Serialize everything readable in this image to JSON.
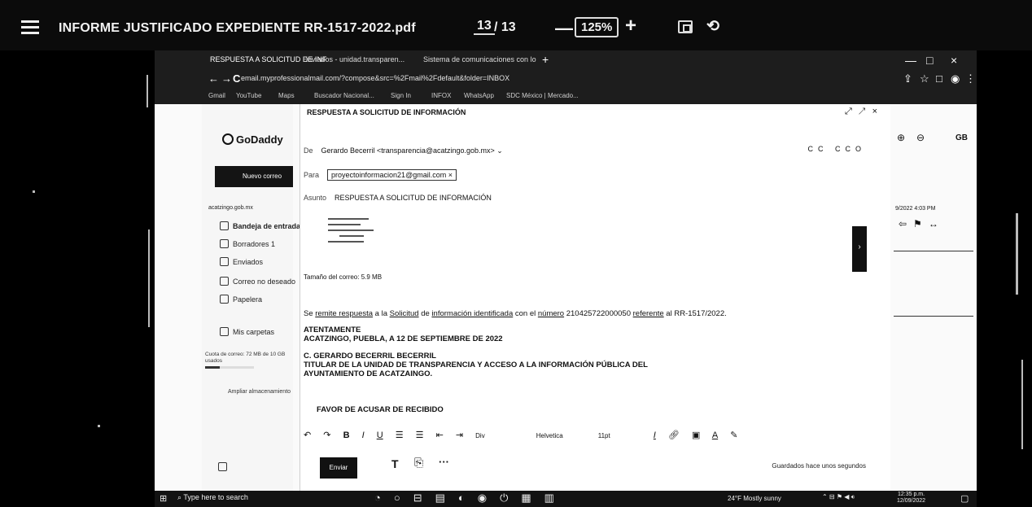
{
  "pdf_viewer": {
    "title": "INFORME JUSTIFICADO EXPEDIENTE RR-1517-2022.pdf",
    "page_current": "13",
    "page_total": "/ 13",
    "zoom": "125%",
    "zoom_out": "—",
    "zoom_in": "+",
    "rotate": "⟲"
  },
  "browser": {
    "tabs": [
      "RESPUESTA A SOLICITUD DE INF",
      "Enviados - unidad.transparen...",
      "Sistema de comunicaciones con lo"
    ],
    "new_tab": "+",
    "window_controls": [
      "—",
      "□",
      "×"
    ],
    "url": "email.myprofessionalmail.com/?compose&src=%2Fmail%2Fdefault&folder=INBOX",
    "nav": {
      "back": "←",
      "forward": "→",
      "reload": "C"
    },
    "bookmarks": [
      "Gmail",
      "YouTube",
      "Maps",
      "Buscador Nacional...",
      "Sign In",
      "INFOX",
      "WhatsApp",
      "SDC México | Mercado..."
    ]
  },
  "mail": {
    "logo": "GoDaddy",
    "new_mail_label": "Nuevo correo",
    "account": "acatzingo.gob.mx",
    "folders": [
      "Bandeja de entrada",
      "Borradores 1",
      "Enviados",
      "Correo no deseado",
      "Papelera",
      "Mis carpetas"
    ],
    "quota": "Cuota de correo: 72 MB de 10 GB usados",
    "more_space": "Ampliar almacenamiento",
    "compose": {
      "title": "RESPUESTA A SOLICITUD DE INFORMACIÓN",
      "from_label": "De",
      "from_value": "Gerardo Becerril <transparencia@acatzingo.gob.mx>",
      "to_label": "Para",
      "to_value": "proyectoinformacion21@gmail.com ×",
      "cc": "CC CCO",
      "subject_label": "Asunto",
      "subject_value": "RESPUESTA A SOLICITUD DE INFORMACIÓN",
      "attachment_size": "Tamaño del correo: 5.9 MB",
      "body_line_pre": "Se ",
      "body_link1": "remite respuesta",
      "body_mid1": " a la ",
      "body_link2": "Solicitud",
      "body_mid2": " de ",
      "body_link3": "información identificada",
      "body_mid3": " con el ",
      "body_link4": "número",
      "body_mid4": " 210425722000050 ",
      "body_link5": "referente",
      "body_tail": " al RR-1517/2022.",
      "closing1": "ATENTAMENTE",
      "closing2": "ACATZINGO, PUEBLA, A 12 DE SEPTIEMBRE DE 2022",
      "sig1": "C. GERARDO BECERRIL BECERRIL",
      "sig2": "TITULAR DE LA UNIDAD DE TRANSPARENCIA Y ACCESO A LA INFORMACIÓN PÚBLICA DEL",
      "sig3": "AYUNTAMIENTO DE ACATZAINGO.",
      "ack": "FAVOR DE ACUSAR DE RECIBIDO",
      "font_name": "Helvetica",
      "font_size": "11pt",
      "send_label": "Enviar",
      "saved_status": "Guardados hace unos segundos"
    },
    "right_pane": {
      "user_initials": "GB",
      "date": "9/2022 4:03 PM"
    }
  },
  "taskbar": {
    "search": "Type here to search",
    "weather": "24°F  Mostly sunny",
    "time": "12:35 p.m.",
    "date": "12/09/2022"
  }
}
